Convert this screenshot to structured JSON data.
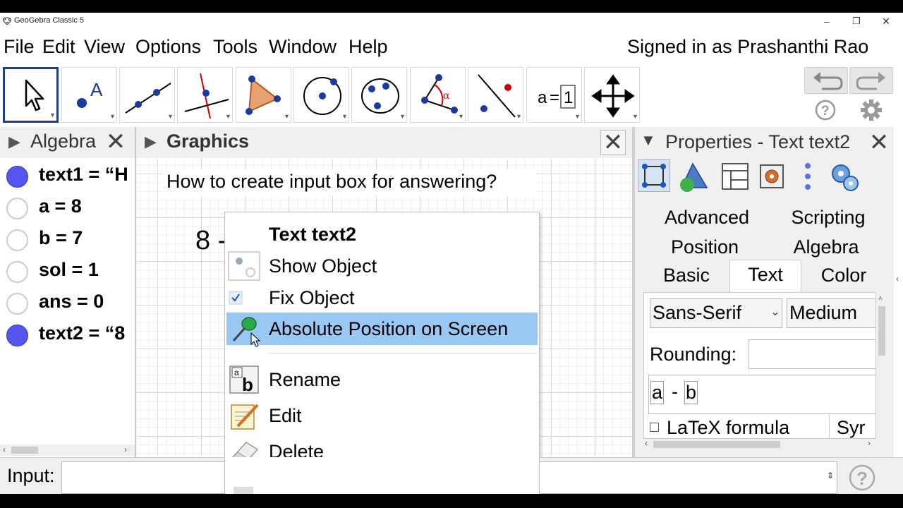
{
  "window": {
    "title": "GeoGebra Classic 5",
    "controls": [
      "–",
      "❐",
      "✕"
    ]
  },
  "menubar": {
    "items": [
      "File",
      "Edit",
      "View",
      "Options",
      "Tools",
      "Window",
      "Help"
    ],
    "signed_in": "Signed in as Prashanthi Rao"
  },
  "toolbar": {
    "tools": [
      {
        "icon": "move-arrow-icon",
        "selected": true
      },
      {
        "icon": "point-icon",
        "label": "A"
      },
      {
        "icon": "line-icon"
      },
      {
        "icon": "perpendicular-line-icon"
      },
      {
        "icon": "polygon-icon"
      },
      {
        "icon": "circle-center-icon"
      },
      {
        "icon": "ellipse-icon"
      },
      {
        "icon": "angle-icon",
        "label": "α"
      },
      {
        "icon": "reflect-icon"
      },
      {
        "icon": "slider-icon",
        "label_a": "a",
        "label_eq": "=",
        "label_1": "1"
      },
      {
        "icon": "move-graphics-icon"
      }
    ]
  },
  "algebra": {
    "title": "Algebra",
    "rows": [
      {
        "text": "text1 = “H",
        "visible": true
      },
      {
        "text": "a = 8",
        "visible": false
      },
      {
        "text": "b = 7",
        "visible": false
      },
      {
        "text": "sol = 1",
        "visible": false
      },
      {
        "text": "ans = 0",
        "visible": false
      },
      {
        "text": "text2 = “8",
        "visible": true
      }
    ]
  },
  "graphics": {
    "title": "Graphics",
    "question": "How to create input box for answering?",
    "partial_text": "8 -"
  },
  "context_menu": {
    "header": "Text text2",
    "items": [
      {
        "label": "Show Object",
        "icon": "show-object-icon"
      },
      {
        "label": "Fix Object",
        "icon": "checkbox-checked-icon",
        "checked": true
      },
      {
        "label": "Absolute Position on Screen",
        "icon": "pin-icon",
        "highlighted": true
      },
      {
        "label": "Rename",
        "icon": "rename-icon"
      },
      {
        "label": "Edit",
        "icon": "edit-icon"
      },
      {
        "label": "Delete",
        "icon": "eraser-icon"
      }
    ]
  },
  "properties": {
    "title": "Properties - Text text2",
    "tabs_row1": [
      "Advanced",
      "Scripting"
    ],
    "tabs_row2": [
      "Position",
      "Algebra"
    ],
    "tabs_row3": [
      "Basic",
      "Text",
      "Color"
    ],
    "active_tab": "Text",
    "font_family": "Sans-Serif",
    "font_size": "Medium",
    "rounding_label": "Rounding:",
    "text_content": {
      "a": "a",
      "op": "-",
      "b": "b"
    },
    "latex_label": "LaTeX formula",
    "symbols_label": "Syr"
  },
  "input_bar": {
    "label": "Input:",
    "value": ""
  },
  "colors": {
    "accent": "#1c3f8f",
    "highlight": "#99c8f5",
    "visible_dot": "#5555f0",
    "panel_bg": "#f0f0f0"
  }
}
